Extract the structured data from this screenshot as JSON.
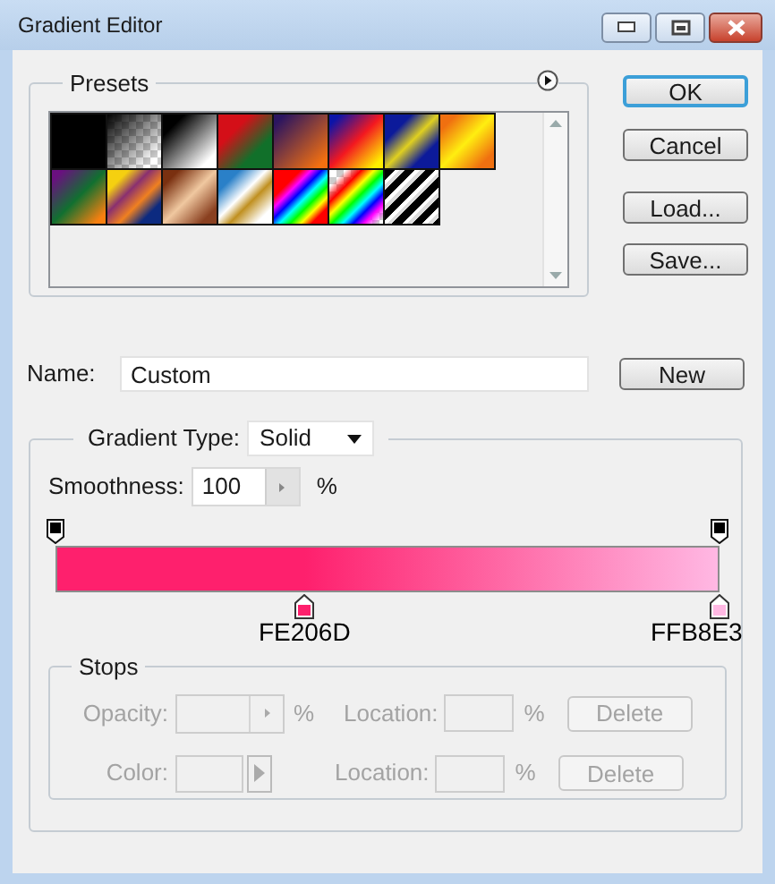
{
  "window": {
    "title": "Gradient Editor"
  },
  "presets": {
    "label": "Presets"
  },
  "buttons": [
    {
      "label": "OK",
      "default": true
    },
    {
      "label": "Cancel",
      "default": false
    },
    {
      "label": "Load...",
      "default": false
    },
    {
      "label": "Save...",
      "default": false
    }
  ],
  "name": {
    "label": "Name:",
    "value": "Custom",
    "button": "New"
  },
  "gradient": {
    "type_label": "Gradient Type:",
    "type_value": "Solid",
    "smoothness_label": "Smoothness:",
    "smoothness_value": "100",
    "smoothness_unit": "%",
    "opacity_stops": [
      {
        "level": 0
      },
      {
        "level": 1
      }
    ],
    "color_stops": [
      {
        "level": 0.375,
        "color": "#fe206d",
        "label": "FE206D"
      },
      {
        "level": 1,
        "color": "#ffb8e3",
        "label": "FFB8E3"
      }
    ]
  },
  "stops": {
    "label": "Stops",
    "disabled": true,
    "rows": [
      {
        "kind": "opacity",
        "label": "Opacity:",
        "unit": "%",
        "location_label": "Location:",
        "location_unit": "%",
        "button": "Delete"
      },
      {
        "kind": "color",
        "label": "Color:",
        "location_label": "Location:",
        "location_unit": "%",
        "button": "Delete"
      }
    ]
  }
}
